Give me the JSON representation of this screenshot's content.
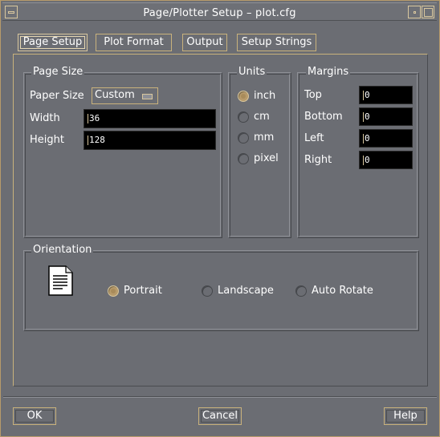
{
  "window": {
    "title": "Page/Plotter Setup – plot.cfg"
  },
  "tabs": [
    {
      "label": "Page Setup",
      "active": true
    },
    {
      "label": "Plot Format",
      "active": false
    },
    {
      "label": "Output",
      "active": false
    },
    {
      "label": "Setup Strings",
      "active": false
    }
  ],
  "page_size": {
    "legend": "Page Size",
    "paper_size_label": "Paper Size",
    "paper_size_value": "Custom",
    "width_label": "Width",
    "width_value": "36",
    "height_label": "Height",
    "height_value": "128"
  },
  "units": {
    "legend": "Units",
    "options": [
      {
        "label": "inch",
        "selected": true
      },
      {
        "label": "cm",
        "selected": false
      },
      {
        "label": "mm",
        "selected": false
      },
      {
        "label": "pixel",
        "selected": false
      }
    ]
  },
  "margins": {
    "legend": "Margins",
    "top_label": "Top",
    "top_value": "0",
    "bottom_label": "Bottom",
    "bottom_value": "0",
    "left_label": "Left",
    "left_value": "0",
    "right_label": "Right",
    "right_value": "0"
  },
  "orientation": {
    "legend": "Orientation",
    "options": [
      {
        "label": "Portrait",
        "selected": true
      },
      {
        "label": "Landscape",
        "selected": false
      },
      {
        "label": "Auto Rotate",
        "selected": false
      }
    ]
  },
  "buttons": {
    "ok": "OK",
    "cancel": "Cancel",
    "help": "Help"
  },
  "colors": {
    "background": "#6b6d73",
    "accent": "#c9b27c",
    "field_bg": "#000000"
  }
}
